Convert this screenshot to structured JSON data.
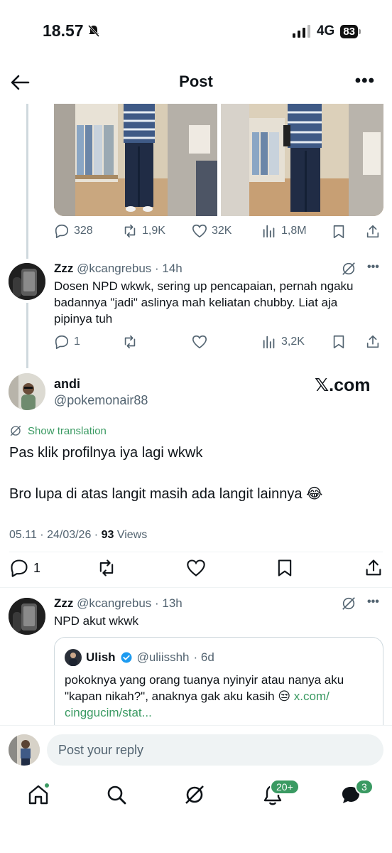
{
  "status": {
    "time": "18.57",
    "network": "4G",
    "battery": "83"
  },
  "header": {
    "title": "Post"
  },
  "top_post_actions": {
    "replies": "328",
    "reposts": "1,9K",
    "likes": "32K",
    "views": "1,8M"
  },
  "reply1": {
    "name": "Zzz",
    "handle": "@kcangrebus",
    "time": "· 14h",
    "text_line1": "Dosen NPD wkwk, sering up pencapaian, pernah ngaku",
    "text_line2": "badannya \"jadi\" aslinya mah keliatan chubby. Liat aja",
    "text_line3": "pipinya tuh",
    "replies": "1",
    "views": "3,2K"
  },
  "main_post": {
    "name": "andi",
    "handle": "@pokemonair88",
    "watermark": "𝕏.com",
    "show_translation": "Show translation",
    "text_line1": "Pas klik profilnya iya lagi wkwk",
    "text_line2": "Bro lupa di atas langit masih ada langit lainnya 😂",
    "time": "05.11 · 24/03/26 · ",
    "views_count": "93",
    "views_label": " Views",
    "replies": "1"
  },
  "reply2": {
    "name": "Zzz",
    "handle": "@kcangrebus",
    "time": "· 13h",
    "text": "NPD akut wkwk",
    "quote": {
      "name": "Ulish",
      "handle": "@uliisshh",
      "time": "· 6d",
      "text_line1": "pokoknya yang orang tuanya nyinyir atau nanya aku",
      "text_line2": "\"kapan nikah?\", anaknya gak aku kasih 😒 ",
      "link1": "x.com/",
      "link2": "cinggucim/stat..."
    }
  },
  "reply_bar": {
    "placeholder": "Post your reply"
  },
  "tabbar": {
    "notifications_badge": "20+",
    "messages_badge": "3"
  },
  "colors": {
    "accent_green": "#3a9a62",
    "text_secondary": "#536471",
    "border": "#cfd9de"
  }
}
